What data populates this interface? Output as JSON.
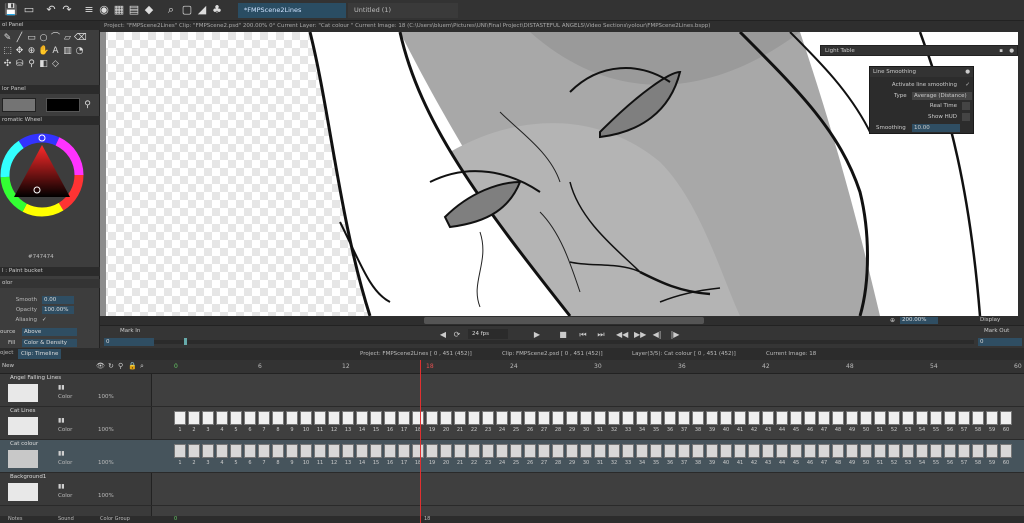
{
  "toolbar": {
    "tabs": [
      {
        "label": "*FMPScene2Lines"
      },
      {
        "label": "Untitled (1)"
      }
    ]
  },
  "infobar": {
    "text": "Project: \"FMPScene2Lines\"  Clip: \"FMPScene2.psd\"  200.00%  0°  Current Layer: \"Cat colour \"  Current Image: 18 (C:\\Users\\bluem\\Pictures\\UNI\\Final Project\\DISTASTEFUL ANGELS\\Video Sections\\yolour\\FMPScene2Lines.bspp)"
  },
  "left": {
    "tool_panel_title": "ol Panel",
    "color_panel_title": "lor Panel",
    "color_wheel_title": "romatic Wheel",
    "hex_value": "#747474",
    "tool_props_title": "l : Paint bucket",
    "tool_props_sub": "olor",
    "props": [
      {
        "label": "Smooth",
        "value": "0.00"
      },
      {
        "label": "Opacity",
        "value": "100.00%"
      },
      {
        "label": "Aliasing",
        "value": ""
      }
    ],
    "source_label": "ource",
    "source_value": "Above",
    "fill_label": "Fill",
    "fill_value": "Color & Density"
  },
  "playback": {
    "mark_in": "Mark In",
    "mark_out": "Mark Out",
    "fps": "24 fps",
    "mark_in_value": "0",
    "mark_out_value": "0",
    "zoom": "200.00%",
    "display": "Display"
  },
  "timeline": {
    "tab_project": "oject",
    "tab_clip": "Clip: Timeline",
    "new_label": "New",
    "info_project": "Project: FMPScene2Lines [ 0 , 451  (452)]",
    "info_clip": "Clip: FMPScene2.psd [ 0 , 451  (452)]",
    "info_layer": "Layer(3/5): Cat colour [ 0 , 451  (452)]",
    "info_image": "Current Image: 18",
    "ruler": [
      "0",
      "6",
      "12",
      "18",
      "24",
      "30",
      "36",
      "42",
      "48",
      "54",
      "60"
    ],
    "layers": [
      {
        "name": "Angel Falling Lines",
        "blend": "Color",
        "opacity": "100%"
      },
      {
        "name": "Cat Lines",
        "blend": "Color",
        "opacity": "100%"
      },
      {
        "name": "Cat colour",
        "blend": "Color",
        "opacity": "100%"
      },
      {
        "name": "Background1",
        "blend": "Color",
        "opacity": "100%"
      }
    ],
    "frame_numbers": [
      "1",
      "2",
      "3",
      "4",
      "5",
      "6",
      "7",
      "8",
      "9",
      "10",
      "11",
      "12",
      "13",
      "14",
      "15",
      "16",
      "17",
      "18",
      "19",
      "20",
      "21",
      "22",
      "23",
      "24",
      "25",
      "26",
      "27",
      "28",
      "29",
      "30",
      "31",
      "32",
      "33",
      "34",
      "35",
      "36",
      "37",
      "38",
      "39",
      "40",
      "41",
      "42",
      "43",
      "44",
      "45",
      "46",
      "47",
      "48",
      "49",
      "50",
      "51",
      "52",
      "53",
      "54",
      "55",
      "56",
      "57",
      "58",
      "59",
      "60",
      "61",
      "62"
    ],
    "bottom_tabs": [
      "Notes",
      "Sound",
      "Color Group"
    ],
    "bottom_ruler": [
      "0",
      "18"
    ]
  },
  "light_table": {
    "title": "Light Table"
  },
  "line_smoothing": {
    "title": "Line Smoothing",
    "activate_label": "Activate line smoothing",
    "type_label": "Type",
    "type_value": "Average (Distance)",
    "real_time": "Real Time",
    "show_hud": "Show HUD",
    "smoothing_label": "Smoothing",
    "smoothing_value": "10.00"
  }
}
